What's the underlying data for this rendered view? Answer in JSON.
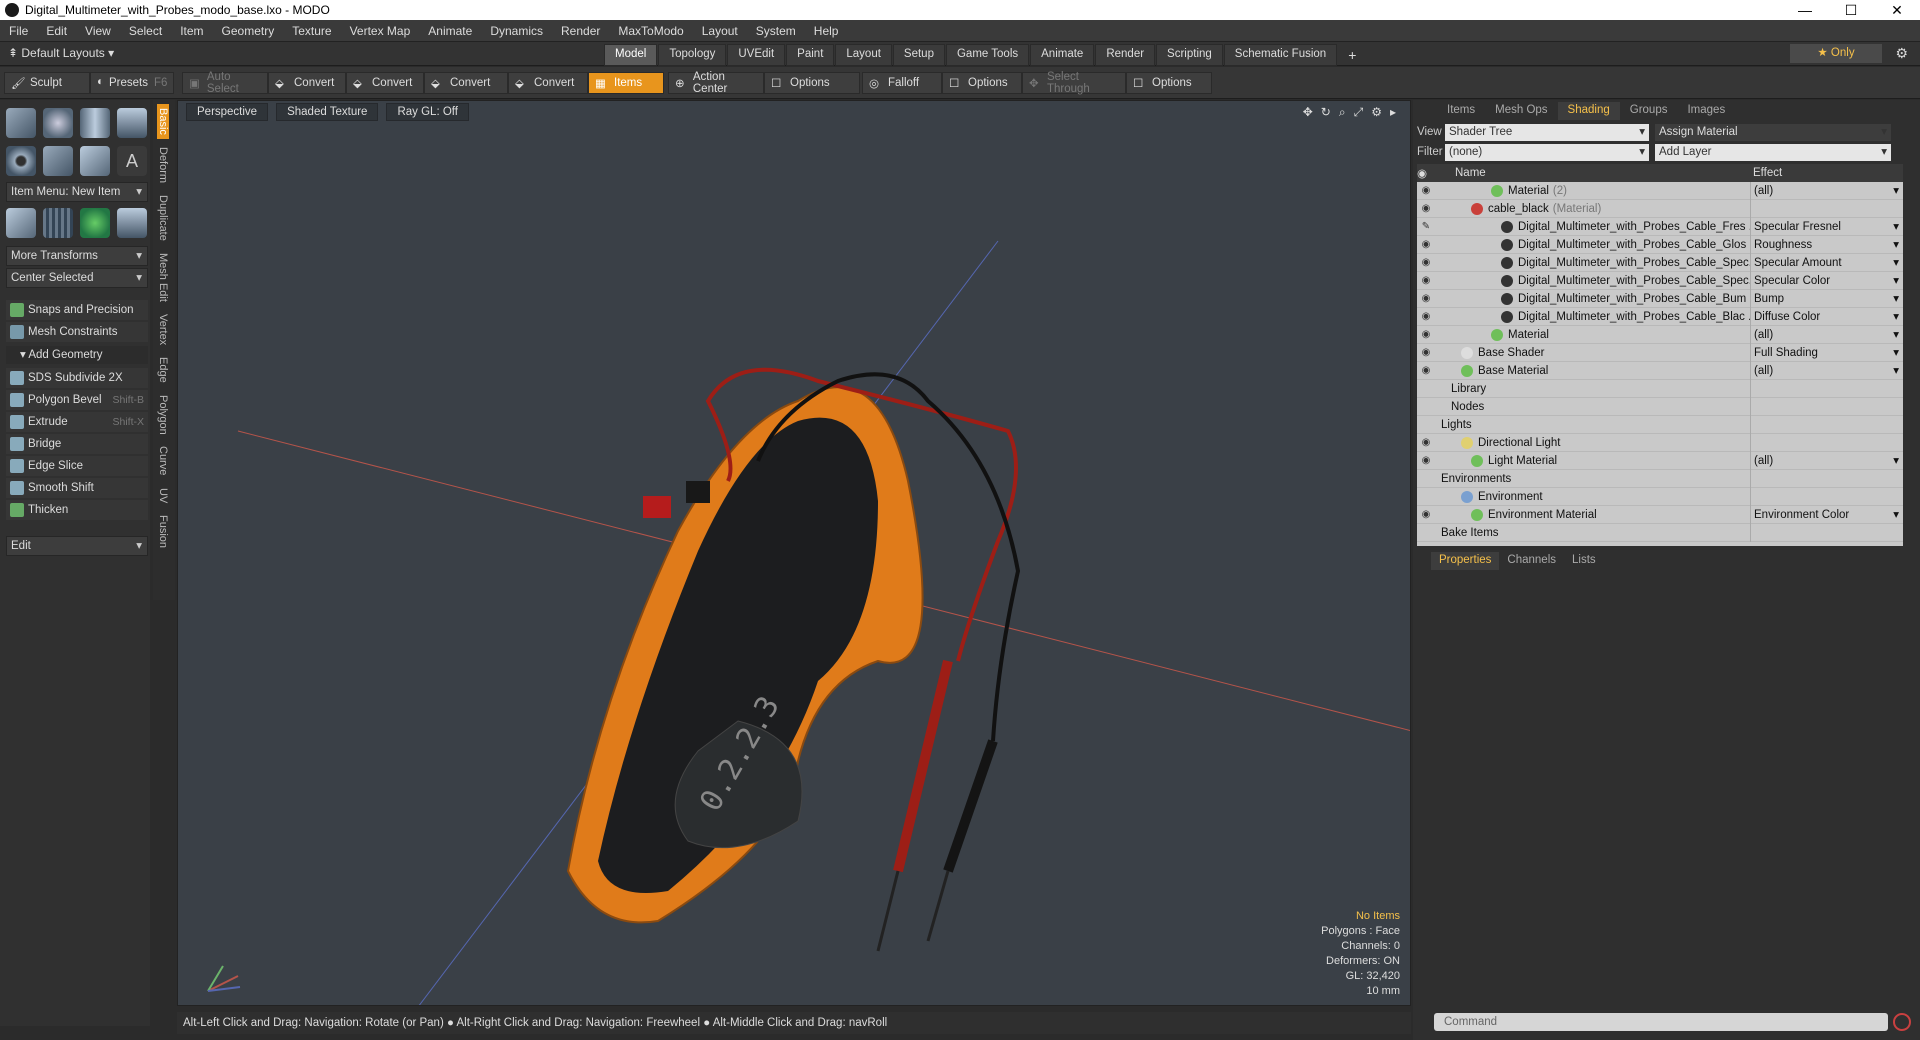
{
  "window": {
    "title": "Digital_Multimeter_with_Probes_modo_base.lxo - MODO",
    "controls": [
      "—",
      "☐",
      "✕"
    ]
  },
  "menu": [
    "File",
    "Edit",
    "View",
    "Select",
    "Item",
    "Geometry",
    "Texture",
    "Vertex Map",
    "Animate",
    "Dynamics",
    "Render",
    "MaxToModo",
    "Layout",
    "System",
    "Help"
  ],
  "layoutbar": {
    "default_layouts": "Default Layouts",
    "tabs": [
      "Model",
      "Topology",
      "UVEdit",
      "Paint",
      "Layout",
      "Setup",
      "Game Tools",
      "Animate",
      "Render",
      "Scripting",
      "Schematic Fusion"
    ],
    "active_tab": "Model",
    "add": "+",
    "only": "★ Only"
  },
  "toolbar": {
    "sculpt": "Sculpt",
    "presets": "Presets",
    "presets_shortcut": "F6",
    "auto_select": "Auto Select",
    "convert1": "Convert",
    "convert2": "Convert",
    "convert3": "Convert",
    "convert4": "Convert",
    "items": "Items",
    "action_center": "Action Center",
    "options1": "Options",
    "falloff": "Falloff",
    "options2": "Options",
    "select_through": "Select Through",
    "options3": "Options"
  },
  "leftpanel": {
    "item_menu": "Item Menu: New Item",
    "more_transforms": "More Transforms",
    "center_selected": "Center Selected",
    "snaps": "Snaps and Precision",
    "mesh_constraints": "Mesh Constraints",
    "add_geometry": "Add Geometry",
    "tools": [
      {
        "label": "SDS Subdivide 2X",
        "shortcut": ""
      },
      {
        "label": "Polygon Bevel",
        "shortcut": "Shift-B"
      },
      {
        "label": "Extrude",
        "shortcut": "Shift-X"
      },
      {
        "label": "Bridge",
        "shortcut": ""
      },
      {
        "label": "Edge Slice",
        "shortcut": ""
      },
      {
        "label": "Smooth Shift",
        "shortcut": ""
      },
      {
        "label": "Thicken",
        "shortcut": ""
      }
    ],
    "edit": "Edit",
    "vtabs": [
      "Basic",
      "Deform",
      "Duplicate",
      "Mesh Edit",
      "Vertex",
      "Edge",
      "Polygon",
      "Curve",
      "UV",
      "Fusion"
    ]
  },
  "viewport": {
    "perspective": "Perspective",
    "shading": "Shaded Texture",
    "raygl": "Ray GL: Off",
    "hud": {
      "no_items": "No Items",
      "polygons": "Polygons : Face",
      "channels": "Channels: 0",
      "deformers": "Deformers: ON",
      "gl": "GL: 32,420",
      "scale": "10 mm"
    },
    "meter_display": "0.2.2.3"
  },
  "statusbar": "Alt-Left Click and Drag: Navigation: Rotate (or Pan) ● Alt-Right Click and Drag: Navigation: Freewheel ● Alt-Middle Click and Drag: navRoll",
  "rightpanel": {
    "tabs": [
      "Items",
      "Mesh Ops",
      "Shading",
      "Groups",
      "Images"
    ],
    "active_tab": "Shading",
    "view_label": "View",
    "view_value": "Shader Tree",
    "assign_material": "Assign Material",
    "filter_label": "Filter",
    "filter_value": "(none)",
    "add_layer": "Add Layer",
    "col_name": "Name",
    "col_effect": "Effect",
    "rows": [
      {
        "name": "Material",
        "sub": "(2)",
        "effect": "(all)",
        "indent": 5,
        "ball": "#6fbf5a",
        "eye": "◉"
      },
      {
        "name": "cable_black",
        "sub": "(Material)",
        "effect": "",
        "indent": 3,
        "ball": "#c9403a",
        "eye": "◉"
      },
      {
        "name": "Digital_Multimeter_with_Probes_Cable_Fres ...",
        "sub": "",
        "effect": "Specular Fresnel",
        "indent": 6,
        "ball": "#333",
        "eye": "✎"
      },
      {
        "name": "Digital_Multimeter_with_Probes_Cable_Glos ...",
        "sub": "",
        "effect": "Roughness",
        "indent": 6,
        "ball": "#333",
        "eye": "◉"
      },
      {
        "name": "Digital_Multimeter_with_Probes_Cable_Spec...",
        "sub": "",
        "effect": "Specular Amount",
        "indent": 6,
        "ball": "#333",
        "eye": "◉"
      },
      {
        "name": "Digital_Multimeter_with_Probes_Cable_Spec...",
        "sub": "",
        "effect": "Specular Color",
        "indent": 6,
        "ball": "#333",
        "eye": "◉"
      },
      {
        "name": "Digital_Multimeter_with_Probes_Cable_Bum ...",
        "sub": "",
        "effect": "Bump",
        "indent": 6,
        "ball": "#333",
        "eye": "◉"
      },
      {
        "name": "Digital_Multimeter_with_Probes_Cable_Blac ...",
        "sub": "",
        "effect": "Diffuse Color",
        "indent": 6,
        "ball": "#333",
        "eye": "◉"
      },
      {
        "name": "Material",
        "sub": "",
        "effect": "(all)",
        "indent": 5,
        "ball": "#6fbf5a",
        "eye": "◉"
      },
      {
        "name": "Base Shader",
        "sub": "",
        "effect": "Full Shading",
        "indent": 2,
        "ball": "#dddddd",
        "eye": "◉"
      },
      {
        "name": "Base Material",
        "sub": "",
        "effect": "(all)",
        "indent": 2,
        "ball": "#6fbf5a",
        "eye": "◉"
      },
      {
        "name": "Library",
        "sub": "",
        "effect": "",
        "indent": 1,
        "ball": "",
        "eye": ""
      },
      {
        "name": "Nodes",
        "sub": "",
        "effect": "",
        "indent": 1,
        "ball": "",
        "eye": ""
      },
      {
        "name": "Lights",
        "sub": "",
        "effect": "",
        "indent": 0,
        "ball": "",
        "eye": ""
      },
      {
        "name": "Directional Light",
        "sub": "",
        "effect": "",
        "indent": 2,
        "ball": "#e0d070",
        "eye": "◉"
      },
      {
        "name": "Light Material",
        "sub": "",
        "effect": "(all)",
        "indent": 3,
        "ball": "#6fbf5a",
        "eye": "◉"
      },
      {
        "name": "Environments",
        "sub": "",
        "effect": "",
        "indent": 0,
        "ball": "",
        "eye": ""
      },
      {
        "name": "Environment",
        "sub": "",
        "effect": "",
        "indent": 2,
        "ball": "#7aa0d0",
        "eye": ""
      },
      {
        "name": "Environment Material",
        "sub": "",
        "effect": "Environment Color",
        "indent": 3,
        "ball": "#6fbf5a",
        "eye": "◉"
      },
      {
        "name": "Bake Items",
        "sub": "",
        "effect": "",
        "indent": 0,
        "ball": "",
        "eye": ""
      }
    ],
    "props_tabs": [
      "Properties",
      "Channels",
      "Lists"
    ],
    "command_placeholder": "Command"
  }
}
